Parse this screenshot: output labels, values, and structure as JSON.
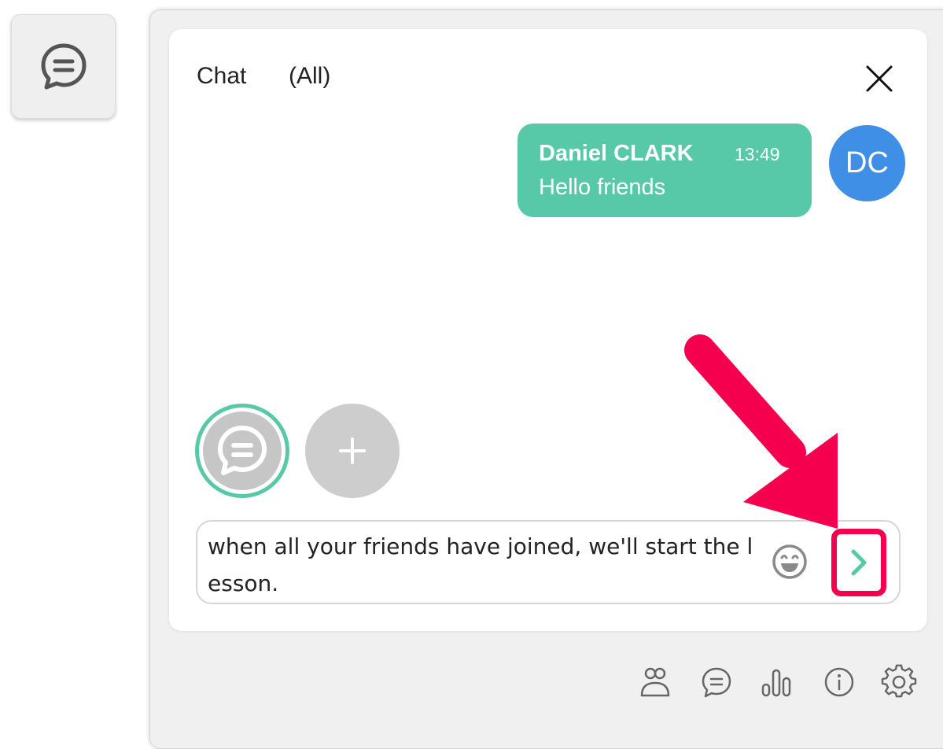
{
  "chat_toggle": {
    "icon": "speech-bubble-icon"
  },
  "header": {
    "title": "Chat",
    "scope": "(All)",
    "close_icon": "close-icon"
  },
  "messages": [
    {
      "sender": "Daniel CLARK",
      "time": "13:49",
      "text": "Hello friends",
      "avatar_initials": "DC",
      "bubble_color": "#58c9a8",
      "avatar_color": "#3f8fe6"
    }
  ],
  "channels": [
    {
      "icon": "speech-bubble-icon",
      "active": true
    },
    {
      "icon": "plus-icon",
      "active": false
    }
  ],
  "composer": {
    "value": "when all your friends have joined, we'll start the lesson.",
    "emoji_icon": "smiley-icon",
    "send_icon": "chevron-right-icon"
  },
  "annotation": {
    "arrow_color": "#f5004f"
  },
  "footer": {
    "icons": [
      "participants-icon",
      "chat-icon",
      "poll-icon",
      "info-icon",
      "settings-icon"
    ]
  },
  "colors": {
    "accent": "#58c9a8",
    "highlight": "#f5004f",
    "avatar": "#3f8fe6"
  }
}
